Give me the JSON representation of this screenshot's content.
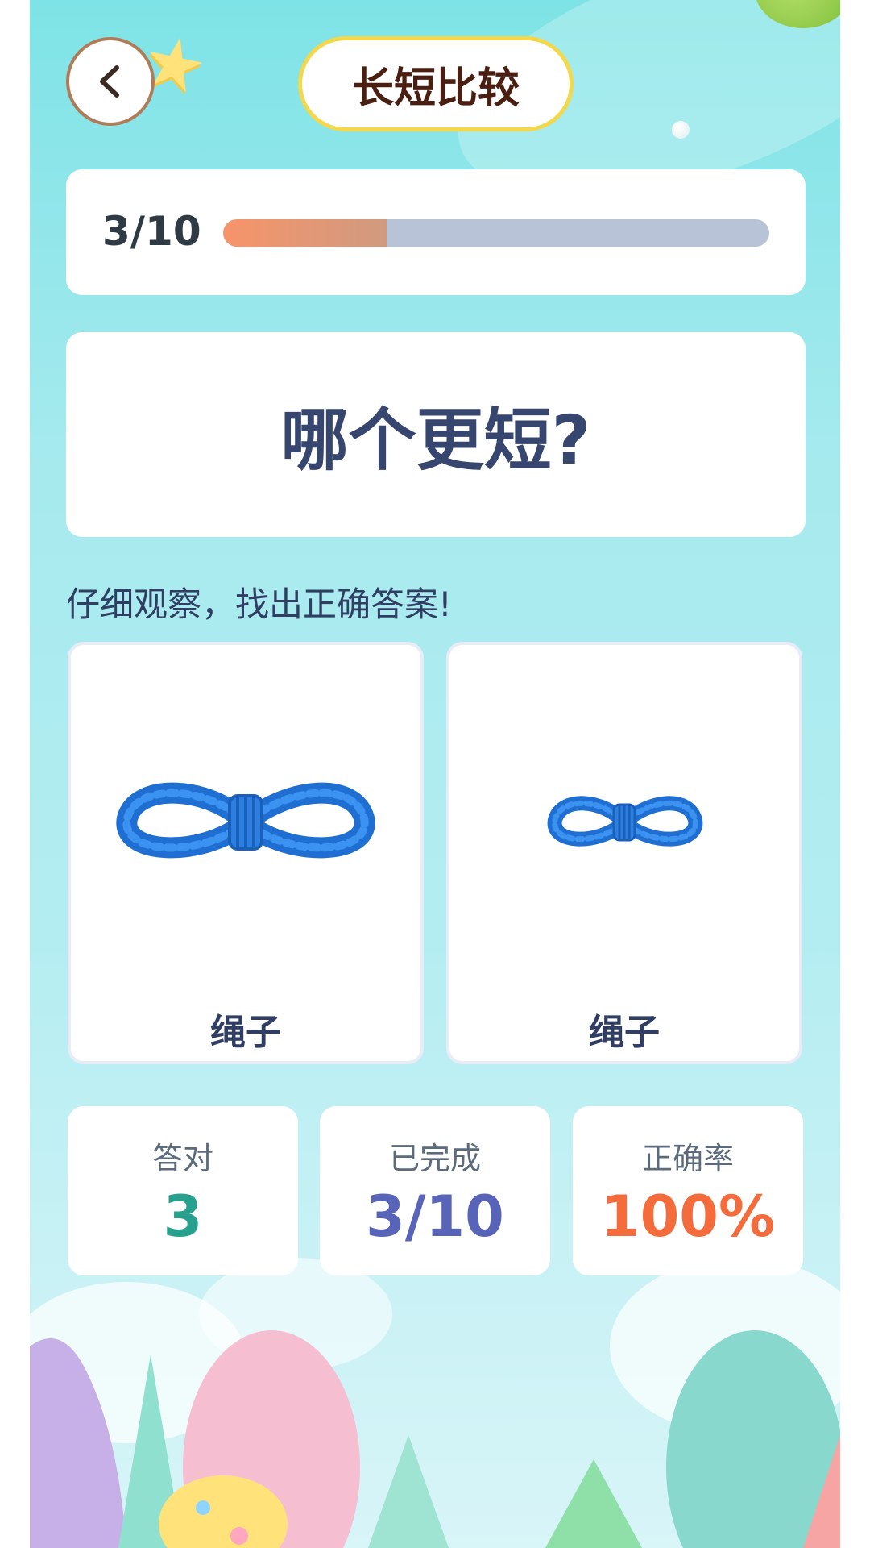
{
  "header": {
    "title": "长短比较"
  },
  "progress": {
    "label": "3/10",
    "current": 3,
    "total": 10,
    "fill_fraction": 0.3,
    "fill_colors": [
      "#f7946a",
      "#d09a80"
    ],
    "track_color": "#b8c3d8"
  },
  "question": {
    "text": "哪个更短?"
  },
  "hint": {
    "text": "仔细观察，找出正确答案!"
  },
  "options": [
    {
      "label": "绳子",
      "icon": "rope-icon",
      "size": "long"
    },
    {
      "label": "绳子",
      "icon": "rope-icon",
      "size": "short"
    }
  ],
  "stats": {
    "correct": {
      "label": "答对",
      "value": "3",
      "color": "#27a08e"
    },
    "completed": {
      "label": "已完成",
      "value": "3/10",
      "color": "#5864b8"
    },
    "accuracy": {
      "label": "正确率",
      "value": "100%",
      "color": "#f46b3c"
    }
  },
  "colors": {
    "rope": "#2a7fe0",
    "title_border": "#f2d84a",
    "back_border": "#b07b58"
  }
}
